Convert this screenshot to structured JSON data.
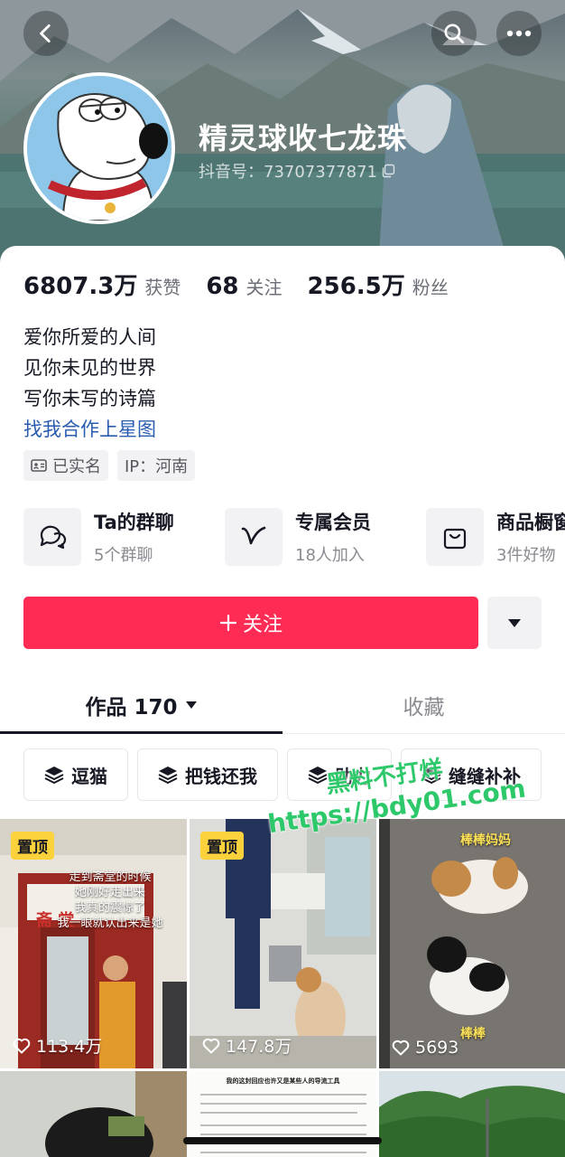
{
  "header": {
    "nickname": "精灵球收七龙珠",
    "douyin_id": "抖音号：73707377871",
    "back_icon": "chevron-left-icon",
    "search_icon": "search-icon",
    "more_icon": "more-dots-icon"
  },
  "stats": [
    {
      "value": "6807.3万",
      "label": "获赞"
    },
    {
      "value": "68",
      "label": "关注"
    },
    {
      "value": "256.5万",
      "label": "粉丝"
    }
  ],
  "bio": {
    "lines": [
      "爱你所爱的人间",
      "见你未见的世界",
      "写你未写的诗篇"
    ],
    "link": "找我合作上星图"
  },
  "tags": {
    "verified": "已实名",
    "ip": "IP：河南"
  },
  "services": [
    {
      "title": "Ta的群聊",
      "sub": "5个群聊",
      "icon": "group-chat-icon"
    },
    {
      "title": "专属会员",
      "sub": "18人加入",
      "icon": "member-v-icon"
    },
    {
      "title": "商品橱窗",
      "sub": "3件好物",
      "icon": "shopping-bag-icon"
    }
  ],
  "follow": {
    "label": "关注"
  },
  "tabs": {
    "works": "作品 170",
    "favorites": "收藏"
  },
  "chips": [
    "逗猫",
    "把钱还我",
    "助力",
    "缝缝补补"
  ],
  "videos": [
    {
      "pinned": "置顶",
      "likes": "113.4万",
      "caption": [
        "走到斋堂的时候",
        "她刚好走出来",
        "我真的震惊了",
        "我一眼就认出来是她"
      ],
      "sign": "斋 堂"
    },
    {
      "pinned": "置顶",
      "likes": "147.8万"
    },
    {
      "likes": "5693",
      "label_top": "棒棒妈妈",
      "label_bottom": "棒棒"
    },
    {},
    {
      "title": "我的这封回应也许又是某些人的导流工具"
    },
    {}
  ],
  "watermark": {
    "line1": "黑料不打烊",
    "line2": "https://bdy01.com"
  },
  "colors": {
    "accent": "#fe2c55",
    "pin": "#fcd23c",
    "link": "#2a5db0"
  }
}
